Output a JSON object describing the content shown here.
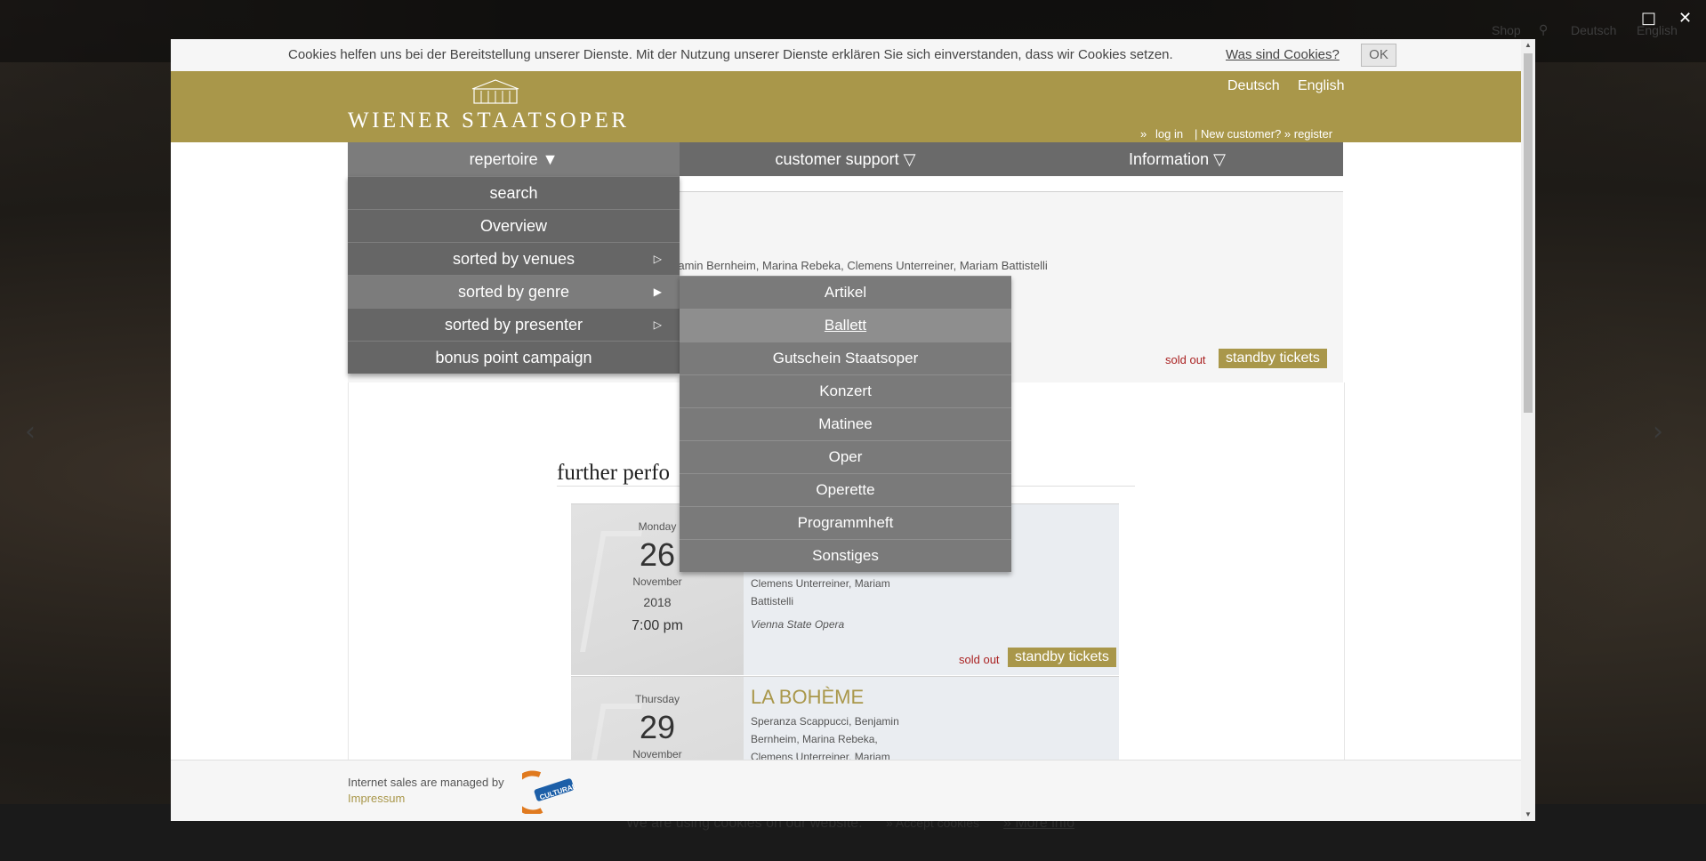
{
  "background": {
    "nav": [
      "Shop",
      "Deutsch",
      "English"
    ],
    "cookie_text": "We are using cookies on our website.",
    "accept": "» Accept cookies",
    "more": "» More info"
  },
  "window_controls": {
    "maximize_icon": "□",
    "close_icon": "✕"
  },
  "cookiebar": {
    "text": "Cookies helfen uns bei der Bereitstellung unserer Dienste. Mit der Nutzung unserer Dienste erklären Sie sich einverstanden, dass wir Cookies setzen.",
    "link": "Was sind Cookies?",
    "ok": "OK"
  },
  "header": {
    "logo_text": "WIENER STAATSOPER",
    "lang_de": "Deutsch",
    "lang_en": "English",
    "login_prefix": "»",
    "login": "log in",
    "register": "| New customer? » register"
  },
  "nav": {
    "repertoire": "repertoire ▼",
    "support": "customer support ▽",
    "information": "Information ▽"
  },
  "menu": {
    "items": [
      {
        "label": "search",
        "arrow": ""
      },
      {
        "label": "Overview",
        "arrow": ""
      },
      {
        "label": "sorted by venues",
        "arrow": "▷"
      },
      {
        "label": "sorted by genre",
        "arrow": "▶"
      },
      {
        "label": "sorted by presenter",
        "arrow": "▷"
      },
      {
        "label": "bonus point campaign",
        "arrow": ""
      }
    ],
    "genre": [
      "Artikel",
      "Ballett",
      "Gutschein Staatsoper",
      "Konzert",
      "Matinee",
      "Oper",
      "Operette",
      "Programmheft",
      "Sonstiges"
    ]
  },
  "content": {
    "cast_partial": "enjamin Bernheim, Marina Rebeka, Clemens Unterreiner, Mariam Battistelli",
    "sold_out": "sold out",
    "standby": "standby tickets",
    "further": "further perfo"
  },
  "performances": [
    {
      "weekday": "Monday",
      "day": "26",
      "month": "November",
      "year": "2018",
      "time": "7:00 pm",
      "cast": "Clemens Unterreiner, Mariam Battistelli",
      "venue": "Vienna State Opera",
      "sold_out": "sold out",
      "standby": "standby tickets"
    },
    {
      "weekday": "Thursday",
      "day": "29",
      "month": "November",
      "title": "LA BOHÈME",
      "cast": "Speranza Scappucci, Benjamin Bernheim, Marina Rebeka, Clemens Unterreiner, Mariam"
    }
  ],
  "footer": {
    "text": "Internet sales are managed by",
    "impressum": "Impressum",
    "logo_text": "CULTURAL"
  },
  "colors": {
    "gold": "#a9974a",
    "nav": "#6a6a6a",
    "sold_out": "#aa2222"
  }
}
